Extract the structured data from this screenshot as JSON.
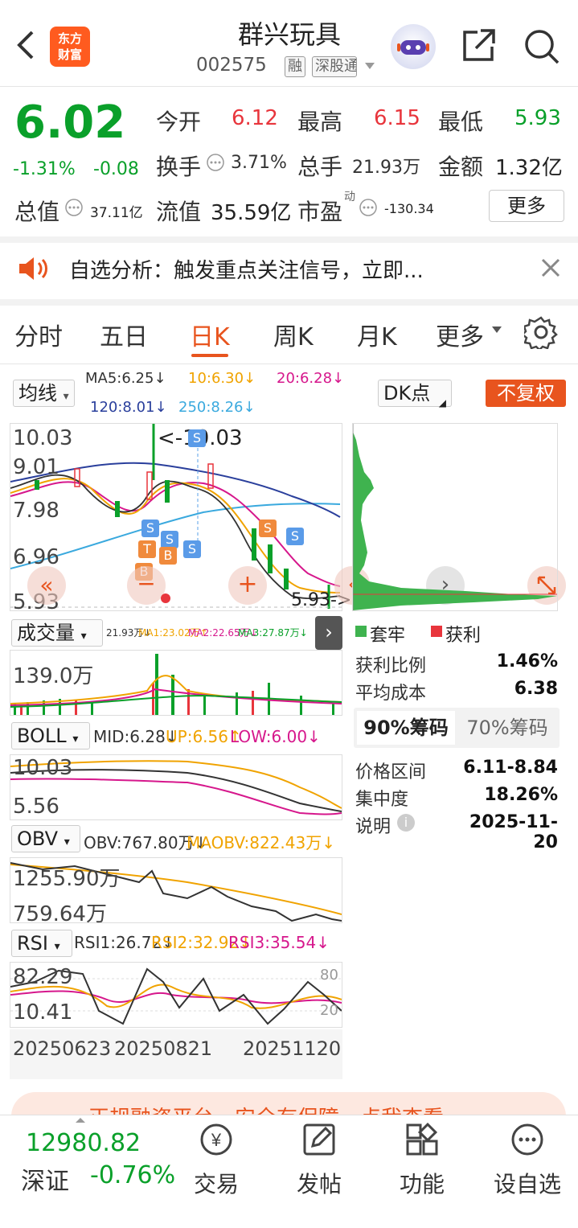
{
  "header": {
    "logo_text": "东方\n财富",
    "stock_name": "群兴玩具",
    "stock_code": "002575",
    "tag_margin": "融",
    "tag_connect": "深股通"
  },
  "quote": {
    "price": "6.02",
    "change_pct": "-1.31%",
    "change_amt": "-0.08",
    "open_label": "今开",
    "open": "6.12",
    "high_label": "最高",
    "high": "6.15",
    "low_label": "最低",
    "low": "5.93",
    "turnover_label": "换手",
    "turnover": "3.71%",
    "volume_label": "总手",
    "volume": "21.93万",
    "amount_label": "金额",
    "amount": "1.32亿",
    "mcap_label": "总值",
    "mcap": "37.11亿",
    "float_label": "流值",
    "float_cap": "35.59亿",
    "pe_label": "市盈",
    "pe_sup": "动",
    "pe": "-130.34",
    "more_label": "更多"
  },
  "notice": {
    "text": "自选分析：触发重点关注信号，立即..."
  },
  "tabs": {
    "items": [
      "分时",
      "五日",
      "日K",
      "周K",
      "月K",
      "更多"
    ],
    "active": "日K"
  },
  "kline": {
    "ma_select": "均线",
    "ma5": "MA5:6.25↓",
    "ma10": "10:6.30↓",
    "ma20": "20:6.28↓",
    "ma120": "120:8.01↓",
    "ma250": "250:8.26↓",
    "dk_select": "DK点",
    "adjust": "不复权",
    "y_labels": [
      "10.03",
      "9.01",
      "7.98",
      "6.96",
      "5.93"
    ],
    "high_mark": "<-10.03",
    "low_mark": "5.93->",
    "signal_s": "S",
    "signal_t": "T",
    "signal_b": "B"
  },
  "volume": {
    "select": "成交量",
    "vol": "21.93万↓",
    "ma1": "MA1:23.02万↑",
    "ma2": "MA2:22.65万↓",
    "ma3": "MA3:27.87万↓",
    "y_label": "139.0万"
  },
  "boll": {
    "select": "BOLL",
    "mid": "MID:6.28↓",
    "up": "UP:6.56↑",
    "low": "LOW:6.00↓",
    "y_top": "10.03",
    "y_bottom": "5.56"
  },
  "obv": {
    "select": "OBV",
    "obv": "OBV:767.80万↓",
    "maobv": "MAOBV:822.43万↓",
    "y_top": "1255.90万",
    "y_bottom": "759.64万"
  },
  "rsi": {
    "select": "RSI",
    "rsi1": "RSI1:26.72↓",
    "rsi2": "RSI2:32.92↓",
    "rsi3": "RSI3:35.54↓",
    "y_top": "82.29",
    "y_bottom": "10.41",
    "ref_80": "80",
    "ref_20": "20"
  },
  "x_axis": {
    "d1": "20250623",
    "d2": "20250821",
    "d3": "20251120"
  },
  "chip": {
    "legend_trapped": "套牢",
    "legend_profit": "获利",
    "profit_ratio_label": "获利比例",
    "profit_ratio": "1.46%",
    "avg_cost_label": "平均成本",
    "avg_cost": "6.38",
    "tab_90": "90%筹码",
    "tab_70": "70%筹码",
    "range_label": "价格区间",
    "range": "6.11-8.84",
    "concentration_label": "集中度",
    "concentration": "18.26%",
    "note_label": "说明",
    "date": "2025-11-20"
  },
  "banner": {
    "text": "正规融资平台，安全有保障，点我查看"
  },
  "bottom": {
    "index_value": "12980.82",
    "index_name": "深证",
    "index_change": "-0.76%",
    "nav": [
      "交易",
      "发帖",
      "功能",
      "设自选"
    ]
  },
  "colors": {
    "up": "#e8353c",
    "down": "#0aa02a",
    "accent": "#e8541e"
  }
}
